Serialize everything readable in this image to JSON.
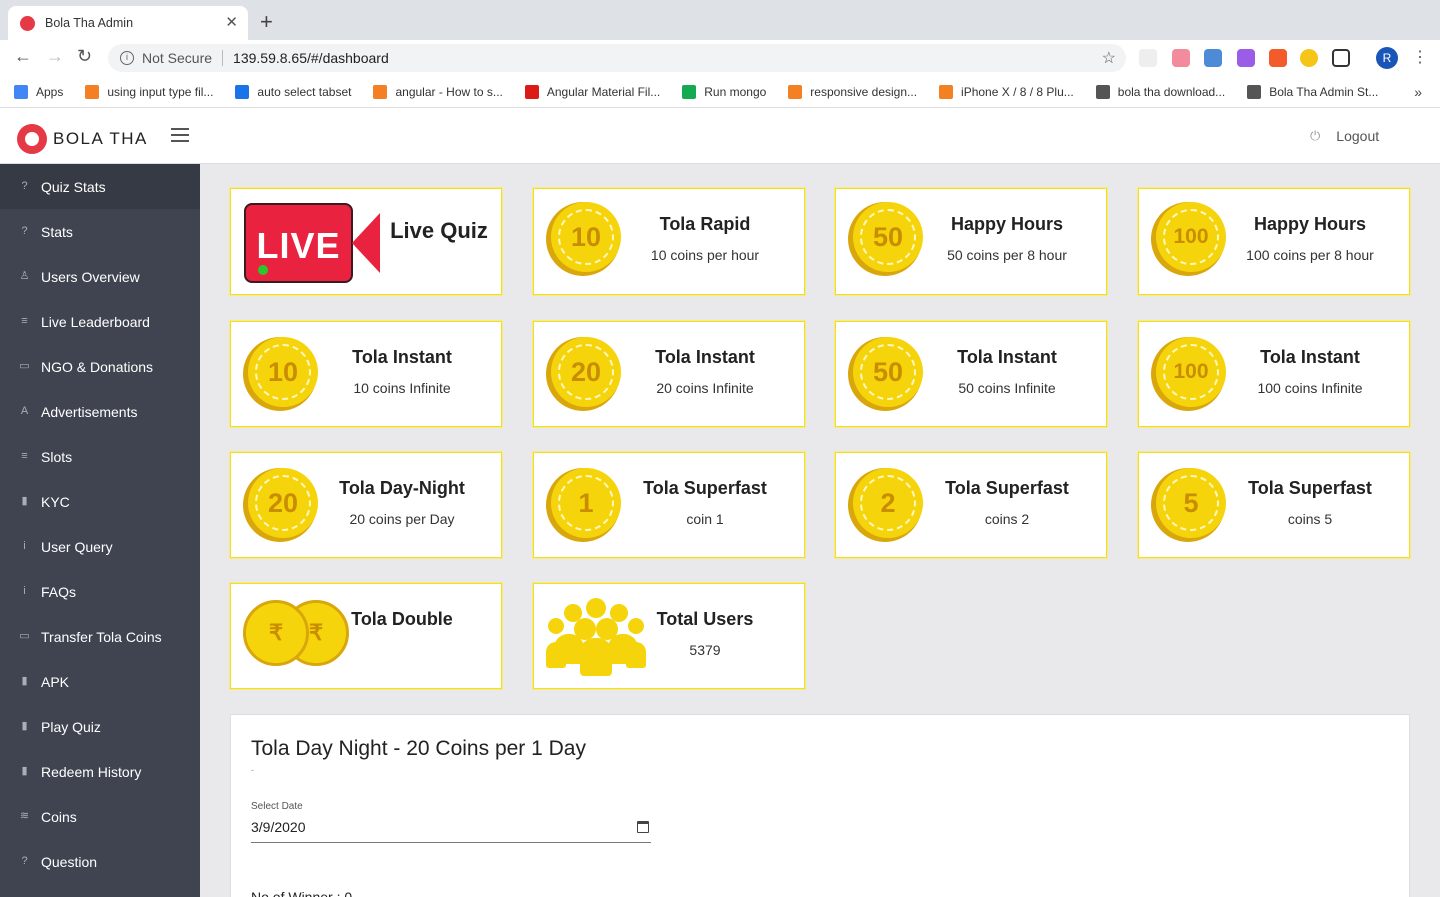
{
  "browser": {
    "tab_title": "Bola Tha Admin",
    "security_label": "Not Secure",
    "url": "139.59.8.65/#/dashboard",
    "profile_initial": "R",
    "bookmarks": [
      {
        "label": "Apps",
        "icon": "apps-grid-icon",
        "color": "#4285f4"
      },
      {
        "label": "using input type fil...",
        "icon": "stackoverflow-icon",
        "color": "#f48024"
      },
      {
        "label": "auto select tabset",
        "icon": "bolt-icon",
        "color": "#1a73e8"
      },
      {
        "label": "angular - How to s...",
        "icon": "stackoverflow-icon",
        "color": "#f48024"
      },
      {
        "label": "Angular Material Fil...",
        "icon": "angular-icon",
        "color": "#dd1b16"
      },
      {
        "label": "Run mongo",
        "icon": "mongo-icon",
        "color": "#13aa52"
      },
      {
        "label": "responsive design...",
        "icon": "stackoverflow-icon",
        "color": "#f48024"
      },
      {
        "label": "iPhone X / 8 / 8 Plu...",
        "icon": "stackoverflow-icon",
        "color": "#f48024"
      },
      {
        "label": "bola tha download...",
        "icon": "globe-icon",
        "color": "#555555"
      },
      {
        "label": "Bola Tha Admin St...",
        "icon": "globe-icon",
        "color": "#555555"
      }
    ]
  },
  "header": {
    "brand": "BOLA THA",
    "logout_label": "Logout"
  },
  "sidebar": {
    "items": [
      {
        "label": "Quiz Stats",
        "icon": "help-circle-icon",
        "active": true
      },
      {
        "label": "Stats",
        "icon": "help-circle-icon"
      },
      {
        "label": "Users Overview",
        "icon": "user-icon"
      },
      {
        "label": "Live Leaderboard",
        "icon": "list-icon"
      },
      {
        "label": "NGO & Donations",
        "icon": "money-icon"
      },
      {
        "label": "Advertisements",
        "icon": "ad-icon"
      },
      {
        "label": "Slots",
        "icon": "list-icon"
      },
      {
        "label": "KYC",
        "icon": "file-icon"
      },
      {
        "label": "User Query",
        "icon": "info-icon"
      },
      {
        "label": "FAQs",
        "icon": "info-icon"
      },
      {
        "label": "Transfer Tola Coins",
        "icon": "money-icon"
      },
      {
        "label": "APK",
        "icon": "file-icon"
      },
      {
        "label": "Play Quiz",
        "icon": "file-icon"
      },
      {
        "label": "Redeem History",
        "icon": "file-icon"
      },
      {
        "label": "Coins",
        "icon": "database-icon"
      },
      {
        "label": "Question",
        "icon": "help-circle-icon"
      }
    ]
  },
  "cards": [
    {
      "title": "Live Quiz",
      "subtitle": "",
      "icon": "live-icon"
    },
    {
      "title": "Tola Rapid",
      "subtitle": "10 coins per hour",
      "coin": "10"
    },
    {
      "title": "Happy Hours",
      "subtitle": "50 coins per 8 hour",
      "coin": "50"
    },
    {
      "title": "Happy Hours",
      "subtitle": "100 coins per 8 hour",
      "coin": "100"
    },
    {
      "title": "Tola Instant",
      "subtitle": "10 coins Infinite",
      "coin": "10"
    },
    {
      "title": "Tola Instant",
      "subtitle": "20 coins Infinite",
      "coin": "20"
    },
    {
      "title": "Tola Instant",
      "subtitle": "50 coins Infinite",
      "coin": "50"
    },
    {
      "title": "Tola Instant",
      "subtitle": "100 coins Infinite",
      "coin": "100"
    },
    {
      "title": "Tola Day-Night",
      "subtitle": "20 coins per Day",
      "coin": "20"
    },
    {
      "title": "Tola Superfast",
      "subtitle": "coin 1",
      "coin": "1"
    },
    {
      "title": "Tola Superfast",
      "subtitle": "coins 2",
      "coin": "2"
    },
    {
      "title": "Tola Superfast",
      "subtitle": "coins 5",
      "coin": "5"
    },
    {
      "title": "Tola Double",
      "subtitle": "",
      "icon": "double-coin-icon",
      "coin_symbol": "₹"
    },
    {
      "title": "Total Users",
      "subtitle": "5379",
      "icon": "users-group-icon"
    }
  ],
  "panel": {
    "title": "Tola Day Night - 20 Coins per 1 Day",
    "dash": "-",
    "date_label": "Select Date",
    "date_value": "3/9/2020",
    "winner_label": "No of Winner : 0"
  },
  "colors": {
    "sidebar_bg": "#3f4450",
    "coin_gold": "#f6d40c",
    "card_border": "#f2dd2a",
    "brand_red": "#e53945"
  }
}
